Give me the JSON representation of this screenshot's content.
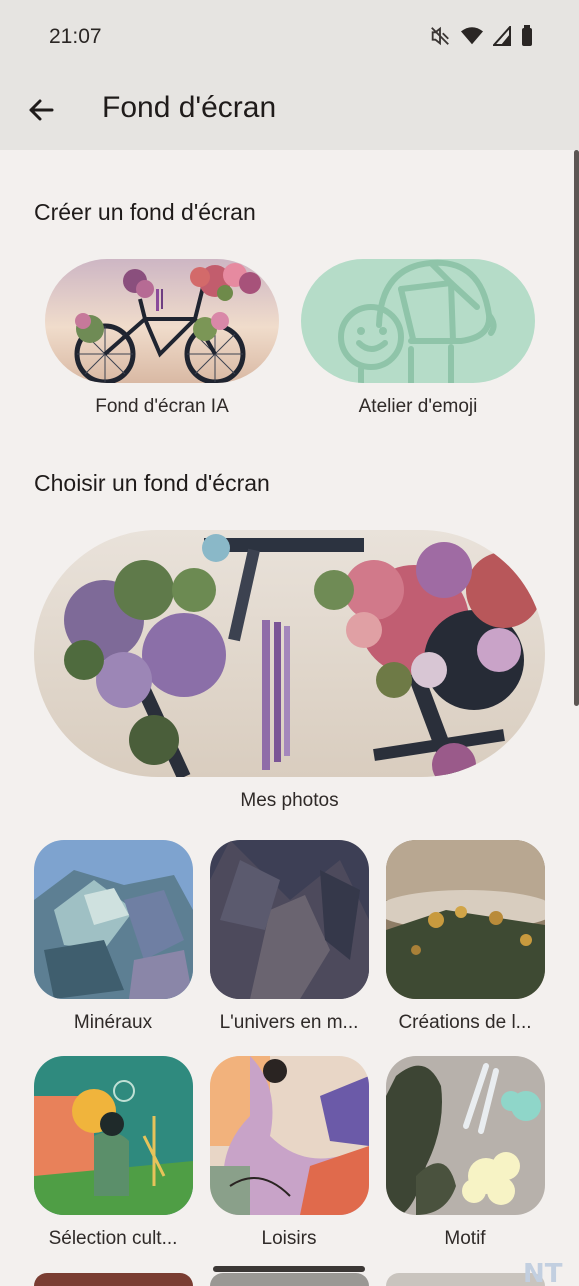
{
  "status": {
    "time": "21:07",
    "icons": [
      "mute-vibrate-icon",
      "wifi-icon",
      "signal-icon",
      "battery-icon"
    ]
  },
  "appbar": {
    "back_icon": "arrow-left-icon",
    "title": "Fond d'écran"
  },
  "create_section": {
    "title": "Créer un fond d'écran",
    "items": [
      {
        "label": "Fond d'écran IA"
      },
      {
        "label": "Atelier d'emoji"
      }
    ]
  },
  "choose_section": {
    "title": "Choisir un fond d'écran",
    "hero": {
      "label": "Mes photos"
    },
    "categories": [
      {
        "label": "Minéraux"
      },
      {
        "label": "L'univers en m..."
      },
      {
        "label": "Créations de l..."
      },
      {
        "label": "Sélection cult..."
      },
      {
        "label": "Loisirs"
      },
      {
        "label": "Motif"
      }
    ]
  },
  "colors": {
    "background": "#f3f0ee",
    "appbar": "#e6e4e1",
    "emoji_tile": "#b5dcc8",
    "emoji_line": "#8fc4a9"
  },
  "watermark": "NT"
}
